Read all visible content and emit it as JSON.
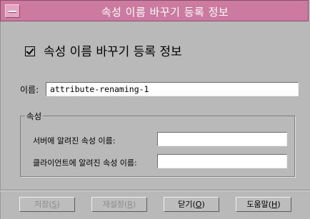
{
  "window": {
    "title": "속성 이름 바꾸기 등록 정보"
  },
  "form": {
    "heading": "속성 이름 바꾸기 등록 정보",
    "name_label": "이름:",
    "name_value": "attribute-renaming-1",
    "group_label": "속성",
    "server_label": "서버에 알려진 속성 이름:",
    "server_value": "",
    "client_label": "클라이언트에 알려진 속성 이름:",
    "client_value": ""
  },
  "buttons": {
    "save": {
      "text": "저장(",
      "mnemonic": "S",
      "suffix": ")",
      "enabled": false
    },
    "reset": {
      "text": "재설정(",
      "mnemonic": "R",
      "suffix": ")",
      "enabled": false
    },
    "close": {
      "text": "닫기(",
      "mnemonic": "O",
      "suffix": ")",
      "enabled": true
    },
    "help": {
      "text": "도움말(",
      "mnemonic": "H",
      "suffix": ")",
      "enabled": true
    }
  },
  "colors": {
    "titlebar": "#cc7aa0",
    "background": "#b9b9b9"
  },
  "icons": {
    "window_menu": "window-menu-icon",
    "heading_check": "checkbox-checked-icon"
  }
}
